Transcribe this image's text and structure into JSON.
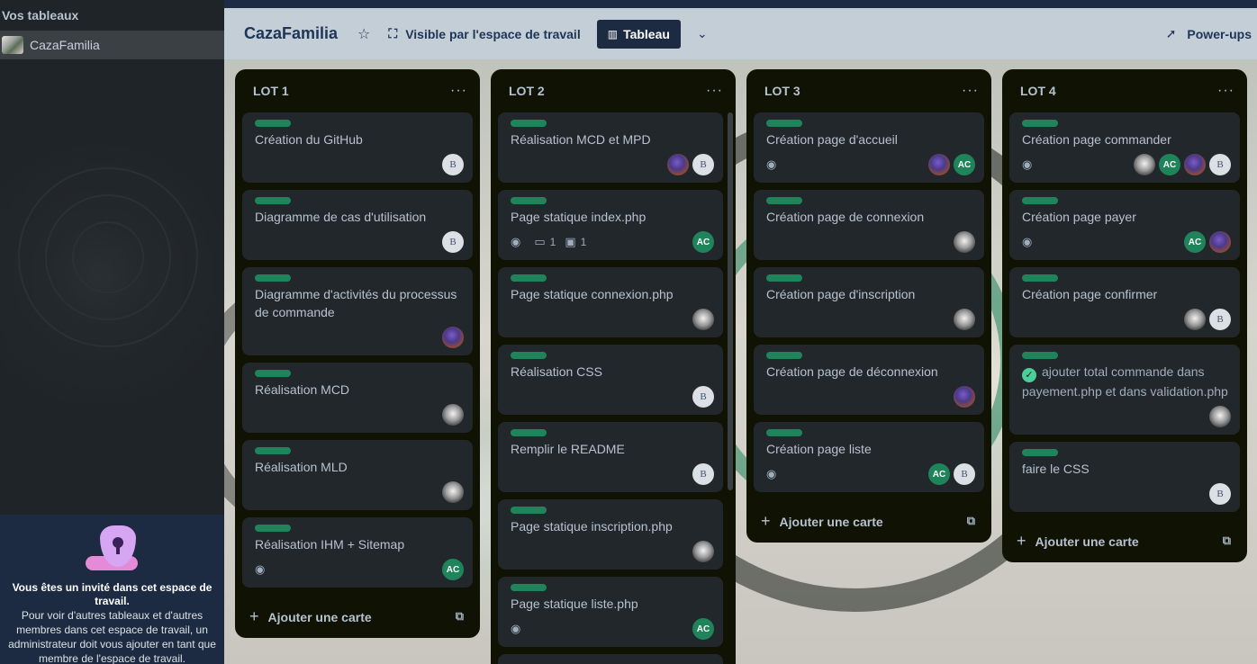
{
  "sidebar": {
    "heading": "Vos tableaux",
    "board_name": "CazaFamilia",
    "guest": {
      "title": "Vous êtes un invité dans cet espace de travail.",
      "text": "Pour voir d'autres tableaux et d'autres membres dans cet espace de travail, un administrateur doit vous ajouter en tant que membre de l'espace de travail."
    }
  },
  "header": {
    "title": "CazaFamilia",
    "visibility": "Visible par l'espace de travail",
    "view": "Tableau",
    "powerups": "Power-ups"
  },
  "colors": {
    "label_green": "#1f845a",
    "list_bg": "#101204",
    "card_bg": "#22272b",
    "header_bg": "#c5cfdb",
    "nav_blue": "#1c2b41"
  },
  "add_card_label": "Ajouter une carte",
  "lists": [
    {
      "title": "LOT 1",
      "cards": [
        {
          "title": "Création du GitHub",
          "members": [
            "B"
          ]
        },
        {
          "title": "Diagramme de cas d'utilisation",
          "members": [
            "B"
          ]
        },
        {
          "title": "Diagramme d'activités du processus de commande",
          "members": [
            "photo"
          ]
        },
        {
          "title": "Réalisation MCD",
          "members": [
            "horse"
          ]
        },
        {
          "title": "Réalisation MLD",
          "members": [
            "horse"
          ]
        },
        {
          "title": "Réalisation IHM + Sitemap",
          "watch": true,
          "members": [
            "AC"
          ]
        }
      ]
    },
    {
      "title": "LOT 2",
      "cards": [
        {
          "title": "Réalisation MCD et MPD",
          "members": [
            "photo",
            "B"
          ]
        },
        {
          "title": "Page statique index.php",
          "watch": true,
          "comments": "1",
          "attachments": "1",
          "members": [
            "AC"
          ]
        },
        {
          "title": "Page statique connexion.php",
          "members": [
            "horse"
          ]
        },
        {
          "title": "Réalisation CSS",
          "members": [
            "B"
          ]
        },
        {
          "title": "Remplir le README",
          "members": [
            "B"
          ]
        },
        {
          "title": "Page statique inscription.php",
          "members": [
            "horse"
          ]
        },
        {
          "title": "Page statique liste.php",
          "watch": true,
          "members": [
            "AC"
          ]
        }
      ]
    },
    {
      "title": "LOT 3",
      "cards": [
        {
          "title": "Création page d'accueil",
          "watch": true,
          "members": [
            "photo",
            "AC"
          ]
        },
        {
          "title": "Création page de connexion",
          "members": [
            "horse"
          ]
        },
        {
          "title": "Création page d'inscription",
          "members": [
            "horse"
          ]
        },
        {
          "title": "Création page de déconnexion",
          "members": [
            "photo"
          ]
        },
        {
          "title": "Création page liste",
          "watch": true,
          "members": [
            "AC",
            "B"
          ]
        }
      ]
    },
    {
      "title": "LOT 4",
      "cards": [
        {
          "title": "Création page commander",
          "watch": true,
          "members": [
            "horse",
            "AC",
            "photo",
            "B"
          ]
        },
        {
          "title": "Création page payer",
          "watch": true,
          "members": [
            "AC",
            "photo"
          ]
        },
        {
          "title": "Création page confirmer",
          "members": [
            "horse",
            "B"
          ]
        },
        {
          "title": "ajouter total commande dans payement.php et dans validation.php",
          "done": true,
          "members": [
            "horse"
          ]
        },
        {
          "title": "faire le CSS",
          "members": [
            "B"
          ]
        }
      ]
    }
  ]
}
